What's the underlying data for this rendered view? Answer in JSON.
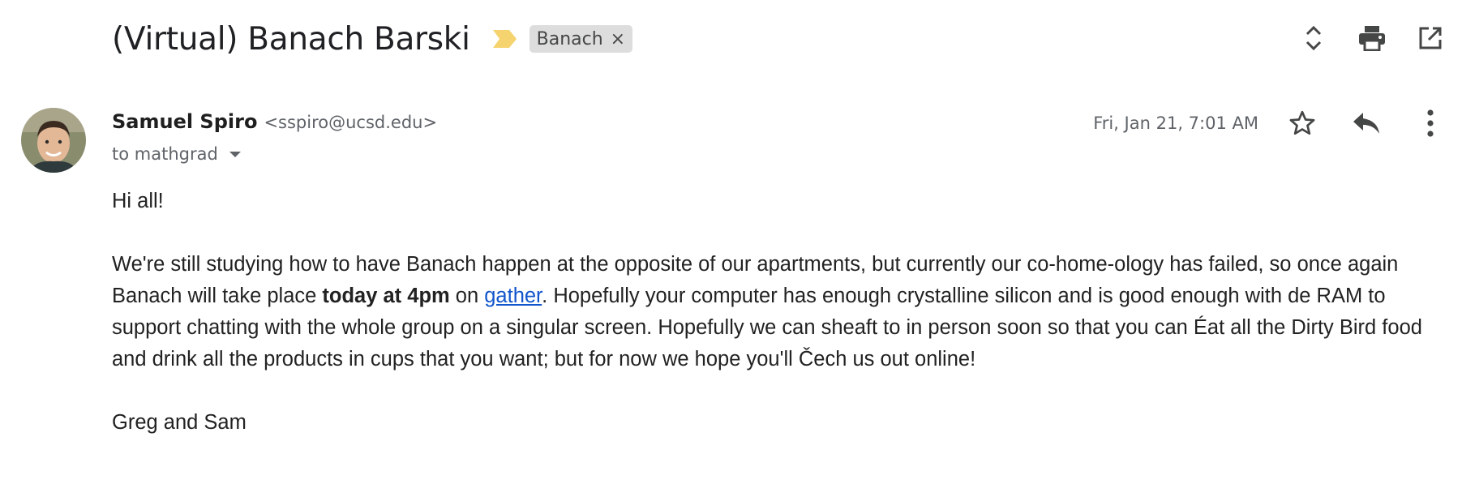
{
  "thread": {
    "subject": "(Virtual) Banach Barski",
    "label": "Banach",
    "importance_color": "#f5d36e"
  },
  "toolbar": {
    "icons": [
      "expand-collapse-icon",
      "print-icon",
      "open-in-new-window-icon"
    ]
  },
  "message": {
    "sender_name": "Samuel Spiro",
    "sender_email": "<sspiro@ucsd.edu>",
    "recipient": "to mathgrad",
    "date": "Fri, Jan 21, 7:01 AM",
    "actions": [
      "star-icon",
      "reply-icon",
      "more-vert-icon"
    ]
  },
  "body": {
    "greeting": "Hi all!",
    "p1_a": "We're still studying how to have Banach happen at the opposite of our apartments, but currently our co-home-ology has failed, so once again Banach will take place ",
    "p1_bold": "today at 4pm",
    "p1_b": " on ",
    "p1_link": "gather",
    "p1_c": ".  Hopefully your computer has enough crystalline silicon and is good enough with de RAM to support chatting with the whole group on a singular screen.  Hopefully we can sheaft to in person soon so that you can Éat all the Dirty Bird food and drink all the products in cups that you want; but for now we hope you'll Čech us out online!",
    "signature": "Greg and Sam"
  },
  "colors": {
    "link": "#1155cc",
    "chip_bg": "#dddddd",
    "secondary_text": "#5f6368"
  }
}
